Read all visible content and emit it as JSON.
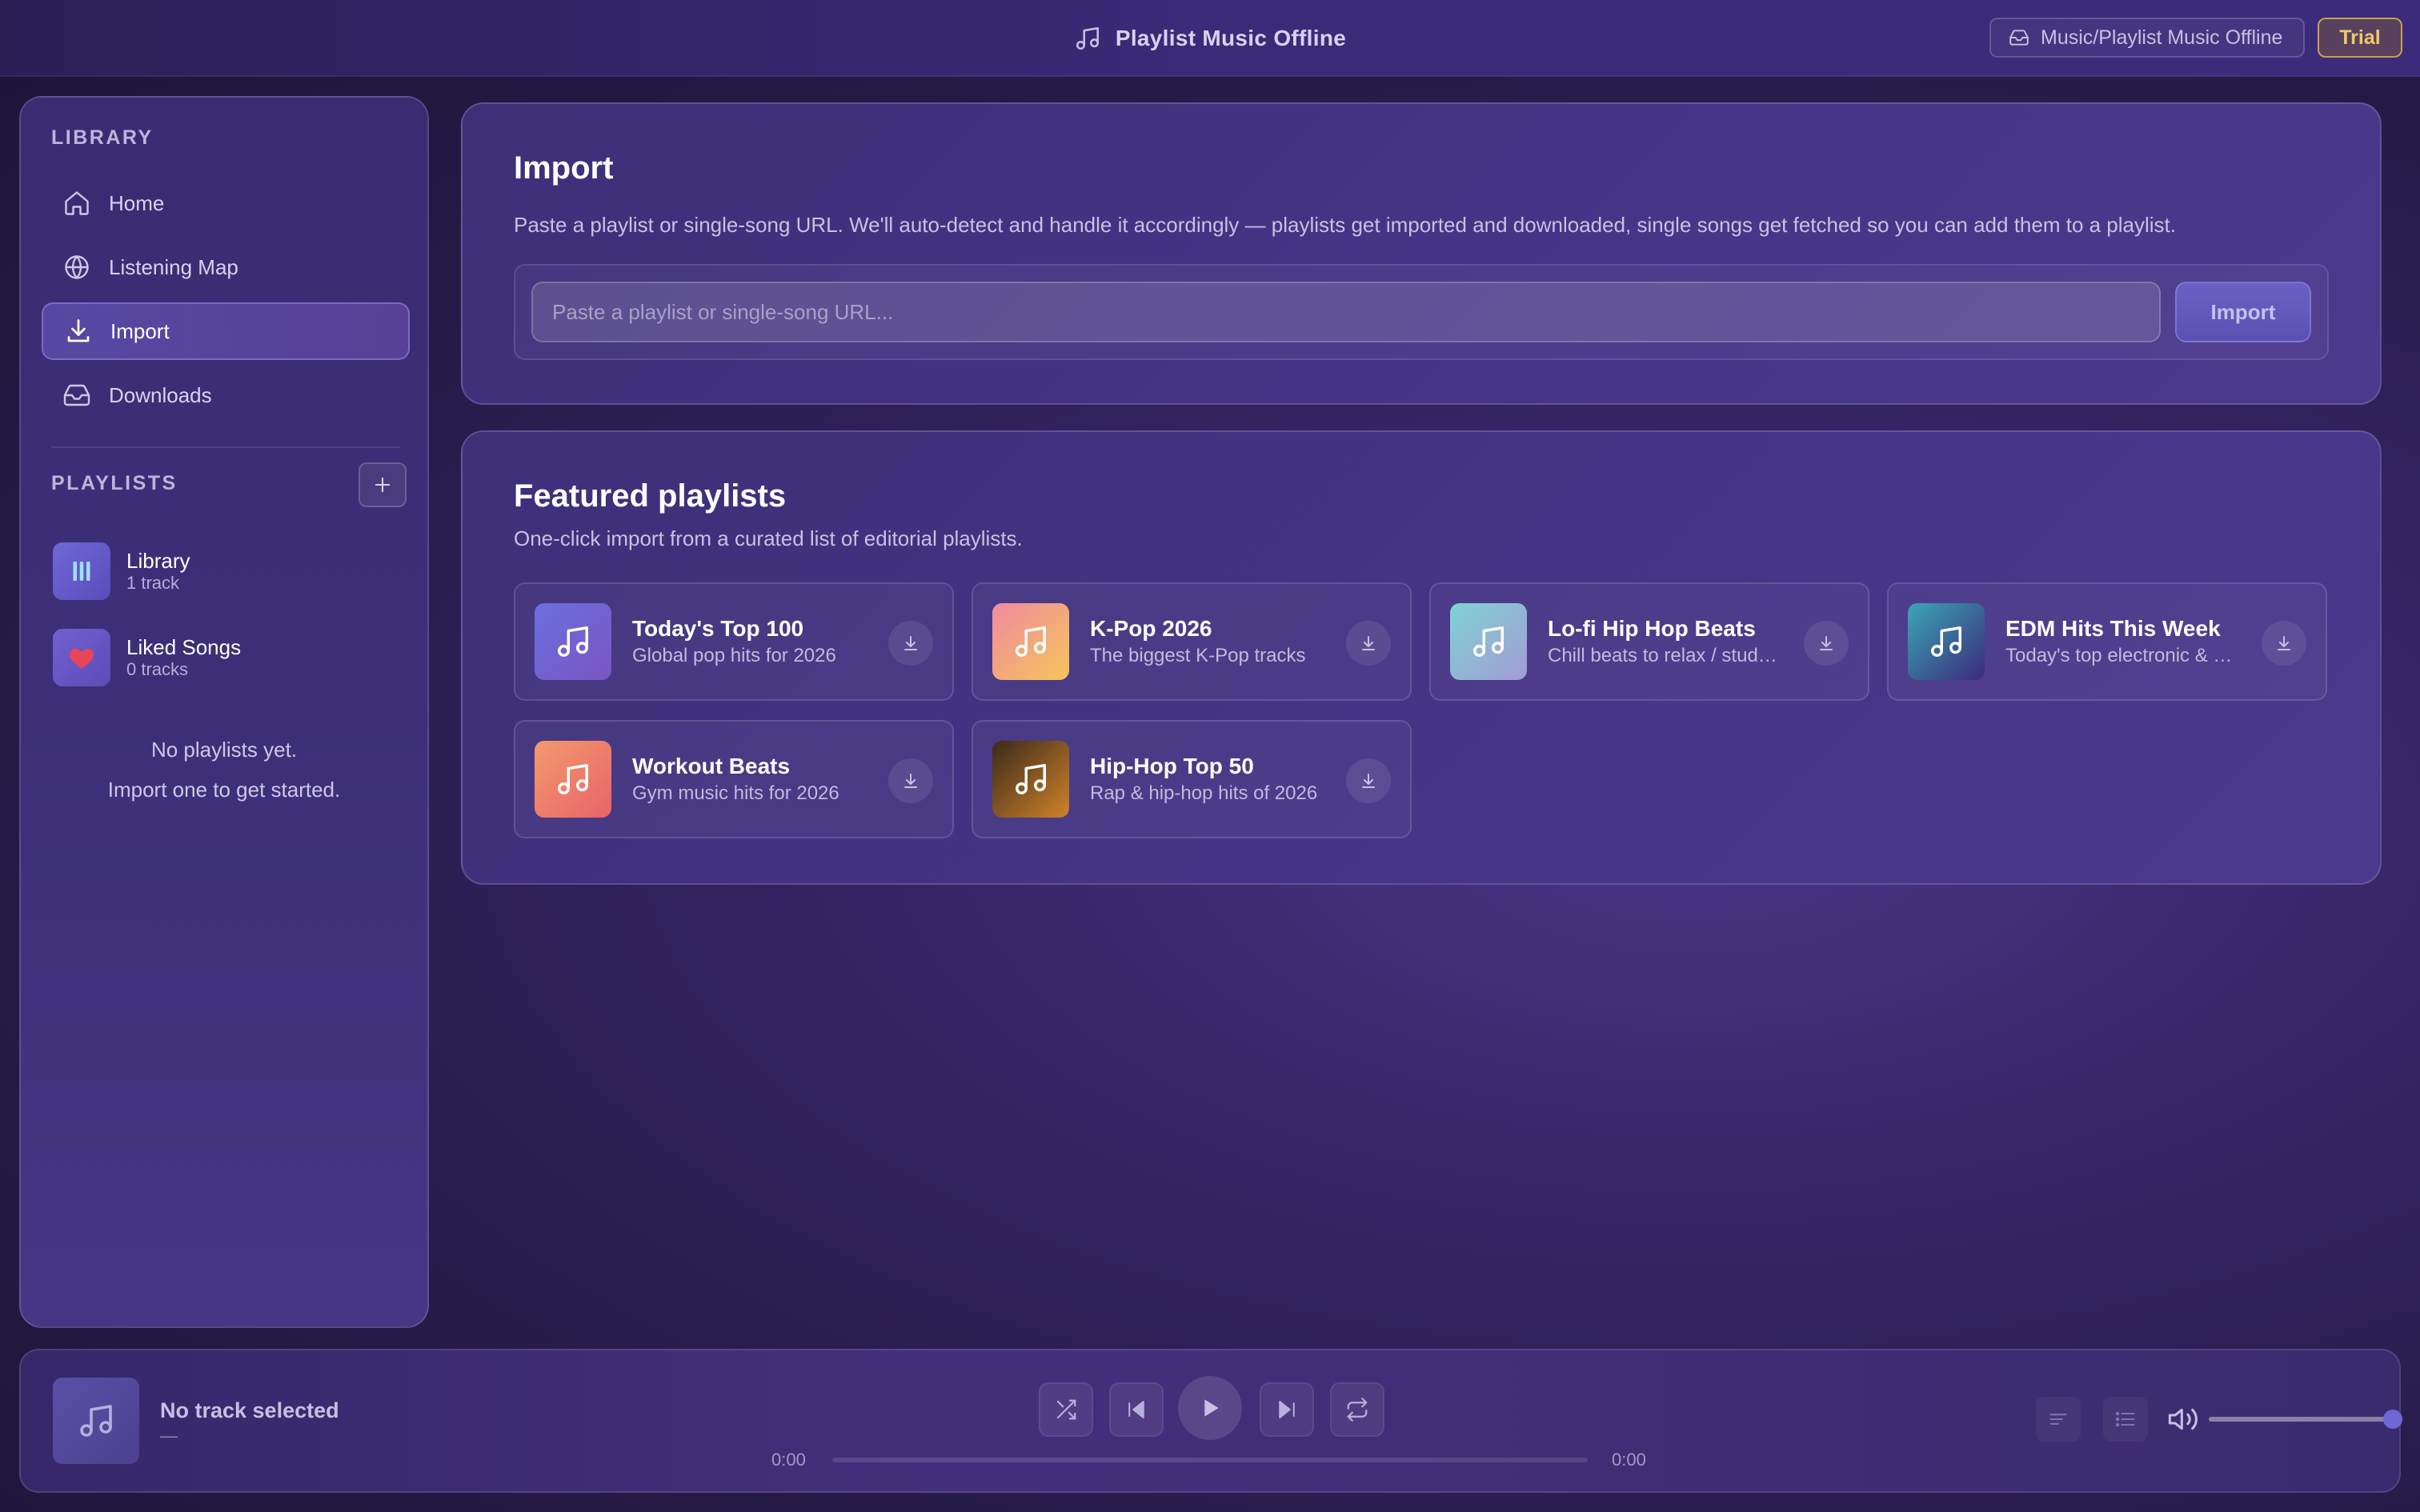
{
  "app": {
    "title": "Playlist Music Offline",
    "path": "Music/Playlist Music Offline",
    "badge": "Trial"
  },
  "sidebar": {
    "library_label": "LIBRARY",
    "nav": [
      {
        "label": "Home",
        "icon": "home-icon"
      },
      {
        "label": "Listening Map",
        "icon": "globe-icon"
      },
      {
        "label": "Import",
        "icon": "download-icon",
        "active": true
      },
      {
        "label": "Downloads",
        "icon": "inbox-icon"
      }
    ],
    "playlists_label": "PLAYLISTS",
    "playlists": [
      {
        "name": "Library",
        "count": "1 track",
        "icon": "bars-icon",
        "color": "#5e5ac8"
      },
      {
        "name": "Liked Songs",
        "count": "0 tracks",
        "icon": "heart-icon",
        "color": "#6a5ac6"
      }
    ],
    "empty_line1": "No playlists yet.",
    "empty_line2": "Import one to get started."
  },
  "import_panel": {
    "title": "Import",
    "description": "Paste a playlist or single-song URL. We'll auto-detect and handle it accordingly — playlists get imported and downloaded, single songs get fetched so you can add them to a playlist.",
    "placeholder": "Paste a playlist or single-song URL...",
    "button": "Import"
  },
  "featured": {
    "title": "Featured playlists",
    "subtitle": "One-click import from a curated list of editorial playlists.",
    "cards": [
      {
        "title": "Today's Top 100",
        "subtitle": "Global pop hits for 2026",
        "gradient": [
          "#6b6fe0",
          "#7a55c0"
        ]
      },
      {
        "title": "K-Pop 2026",
        "subtitle": "The biggest K-Pop tracks",
        "gradient": [
          "#f08aa0",
          "#f5c55a"
        ]
      },
      {
        "title": "Lo-fi Hip Hop Beats",
        "subtitle": "Chill beats to relax / study to",
        "gradient": [
          "#7fd3d3",
          "#a39bd6"
        ]
      },
      {
        "title": "EDM Hits This Week",
        "subtitle": "Today's top electronic & dance hits",
        "gradient": [
          "#3aa6b5",
          "#3b2a7a"
        ]
      },
      {
        "title": "Workout Beats",
        "subtitle": "Gym music hits for 2026",
        "gradient": [
          "#f39a6c",
          "#e8646a"
        ]
      },
      {
        "title": "Hip-Hop Top 50",
        "subtitle": "Rap & hip-hop hits of 2026",
        "gradient": [
          "#3a2a1a",
          "#d0822a"
        ]
      }
    ]
  },
  "player": {
    "track_title": "No track selected",
    "track_artist": "—",
    "time_current": "0:00",
    "time_total": "0:00",
    "volume": 1.0
  },
  "colors": {
    "accent": "#6f67d6",
    "trial": "#f0c86a",
    "heart": "#e8445a"
  }
}
